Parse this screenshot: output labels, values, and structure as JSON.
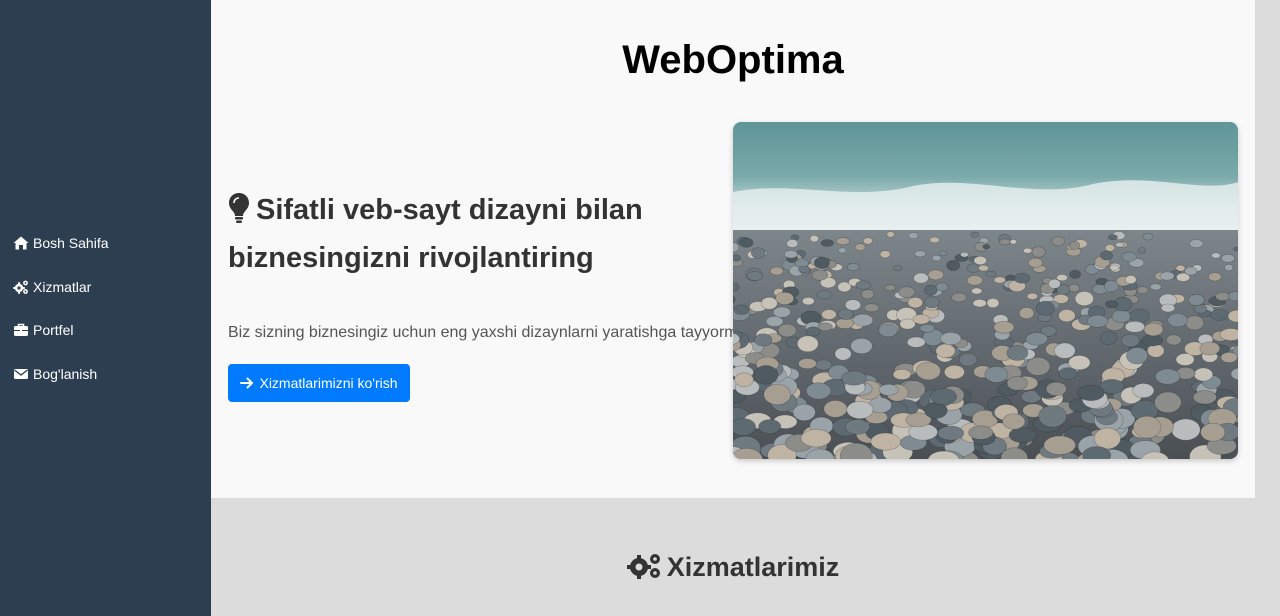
{
  "sidebar": {
    "items": [
      {
        "label": "Bosh Sahifa",
        "icon": "home-icon"
      },
      {
        "label": "Xizmatlar",
        "icon": "cogs-icon"
      },
      {
        "label": "Portfel",
        "icon": "briefcase-icon"
      },
      {
        "label": "Bog'lanish",
        "icon": "envelope-icon"
      }
    ]
  },
  "hero": {
    "site_title": "WebOptima",
    "heading": "Sifatli veb-sayt dizayni bilan biznesingizni rivojlantiring",
    "text": "Biz sizning biznesingiz uchun eng yaxshi dizaynlarni yaratishga tayyormiz.",
    "cta_label": "Xizmatlarimizni ko'rish",
    "image": "pebble-beach-photo"
  },
  "services": {
    "title": "Xizmatlarimiz"
  },
  "colors": {
    "sidebar_bg": "#2c3e50",
    "accent": "#007bff",
    "hero_bg": "#f9f9f9",
    "page_bg": "#dcdcdc"
  }
}
